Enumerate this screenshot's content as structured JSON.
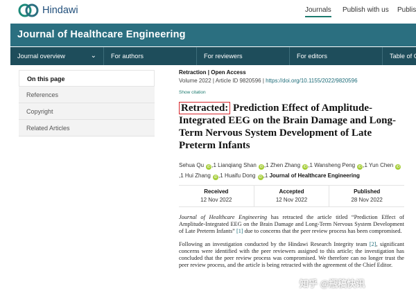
{
  "site": {
    "logo_text": "Hindawi",
    "nav": [
      "Journals",
      "Publish with us",
      "Publis"
    ]
  },
  "journal": {
    "title": "Journal of Healthcare Engineering",
    "subnav": [
      "Journal overview",
      "For authors",
      "For reviewers",
      "For editors",
      "Table of C"
    ]
  },
  "sidebar": {
    "items": [
      "On this page",
      "References",
      "Copyright",
      "Related Articles"
    ]
  },
  "article": {
    "type": "Retraction | Open Access",
    "volume": "Volume 2022 | Article ID 9820596 | ",
    "doi": "https://doi.org/10.1155/2022/9820596",
    "show_citation": "Show citation",
    "title_prefix": "Retracted:",
    "title": " Prediction Effect of Amplitude-Integrated EEG on the Brain Damage and Long-Term Nervous System Development of Late Preterm Infants",
    "authors": [
      "Sehua Qu",
      "Lianqiang Shan",
      "Zhen Zhang",
      "Wansheng Peng",
      "Yun Chen",
      "Hui Zhang",
      "Huaifu Dong"
    ],
    "author_sup": ",1",
    "journal_name": "Journal of Healthcare Engineering",
    "orcid_label": "iD",
    "dates": [
      {
        "label": "Received",
        "value": "12 Nov 2022"
      },
      {
        "label": "Accepted",
        "value": "12 Nov 2022"
      },
      {
        "label": "Published",
        "value": "28 Nov 2022"
      }
    ],
    "para1_journal": "Journal of Healthcare Engineering",
    "para1_a": " has retracted the article titled “Prediction Effect of Amplitude-Integrated EEG on the Brain Damage and Long-Term Nervous System Development of Late Preterm Infants” ",
    "para1_ref": "[1]",
    "para1_b": " due to concerns that the peer review process has been compromised.",
    "para2_a": "Following an investigation conducted by the Hindawi Research Integrity team ",
    "para2_ref": "[2]",
    "para2_b": ", significant concerns were identified with the peer reviewers assigned to this article; the investigation has concluded that the peer review process was compromised. We therefore can no longer trust the peer review process, and the article is being retracted with the agreement of the Chief Editor."
  },
  "watermark": "知乎 @瓶稿快讯",
  "colors": {
    "header": "#2b6f80",
    "subnav": "#1e4d5b",
    "retracted_box": "#d6262c",
    "link": "#1c6b78",
    "orcid": "#a6ce39"
  }
}
